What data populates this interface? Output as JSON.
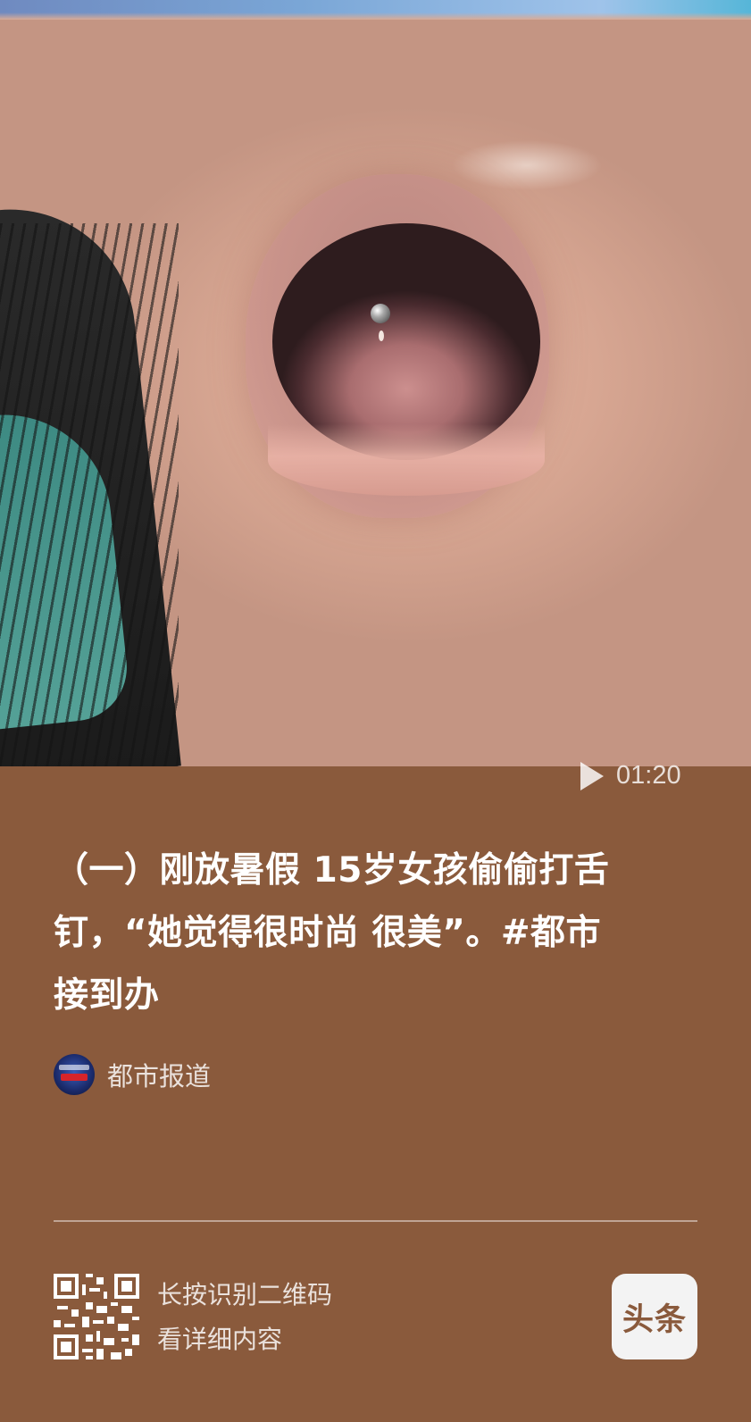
{
  "video": {
    "duration": "01:20"
  },
  "post": {
    "title_lines": [
      "（一）刚放暑假  15岁女孩偷偷打舌",
      "钉，“她觉得很时尚 很美”。#都市",
      "接到办"
    ]
  },
  "author": {
    "name": "都市报道"
  },
  "footer": {
    "qr_hint_line1": "长按识别二维码",
    "qr_hint_line2": "看详细内容",
    "logo_text": "头条"
  },
  "colors": {
    "background": "#8a5a3c",
    "logo_bg": "#f3f3f3"
  }
}
